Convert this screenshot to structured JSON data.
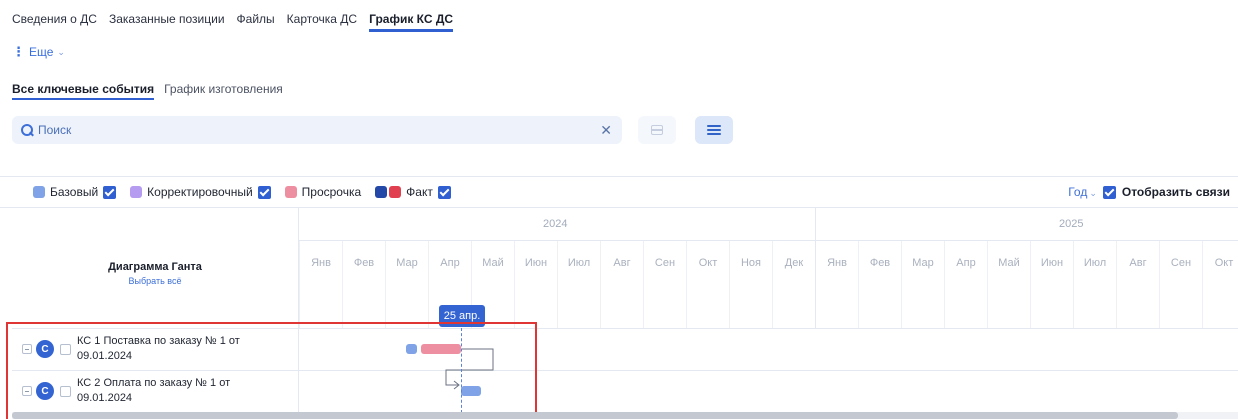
{
  "tabs": [
    "Сведения о ДС",
    "Заказанные позиции",
    "Файлы",
    "Карточка ДС",
    "График КС ДС"
  ],
  "more_label": "Еще",
  "subtabs": [
    "Все ключевые события",
    "График изготовления"
  ],
  "search": {
    "placeholder": "Поиск",
    "value": ""
  },
  "legend": {
    "items": [
      {
        "label": "Базовый",
        "color": "#7fa3e6",
        "checked": true
      },
      {
        "label": "Корректировочный",
        "color": "#b69cf0",
        "checked": true
      },
      {
        "label": "Просрочка",
        "color": "#ee8fa1",
        "checked": false
      },
      {
        "label": "Факт",
        "colors": [
          "#2448a8",
          "#e0404f"
        ],
        "checked": true
      }
    ],
    "scale_label": "Год",
    "show_links_label": "Отобразить связи",
    "show_links_checked": true
  },
  "gantt": {
    "title": "Диаграмма Ганта",
    "select_all": "Выбрать всё",
    "years": [
      "2024",
      "2025"
    ],
    "months": [
      "Янв",
      "Фев",
      "Мар",
      "Апр",
      "Май",
      "Июн",
      "Июл",
      "Авг",
      "Сен",
      "Окт",
      "Ноя",
      "Дек"
    ],
    "today_label": "25 апр.",
    "tasks": [
      {
        "avatar": "С",
        "label": "КС 1 Поставка по заказу № 1 от 09.01.2024"
      },
      {
        "avatar": "С",
        "label": "КС 2 Оплата по заказу № 1 от 09.01.2024"
      }
    ]
  },
  "colors": {
    "accent": "#2f5fd0",
    "base_bar": "#7fa3e6",
    "overdue_bar": "#ee8fa1",
    "selection_frame": "#e03535"
  }
}
